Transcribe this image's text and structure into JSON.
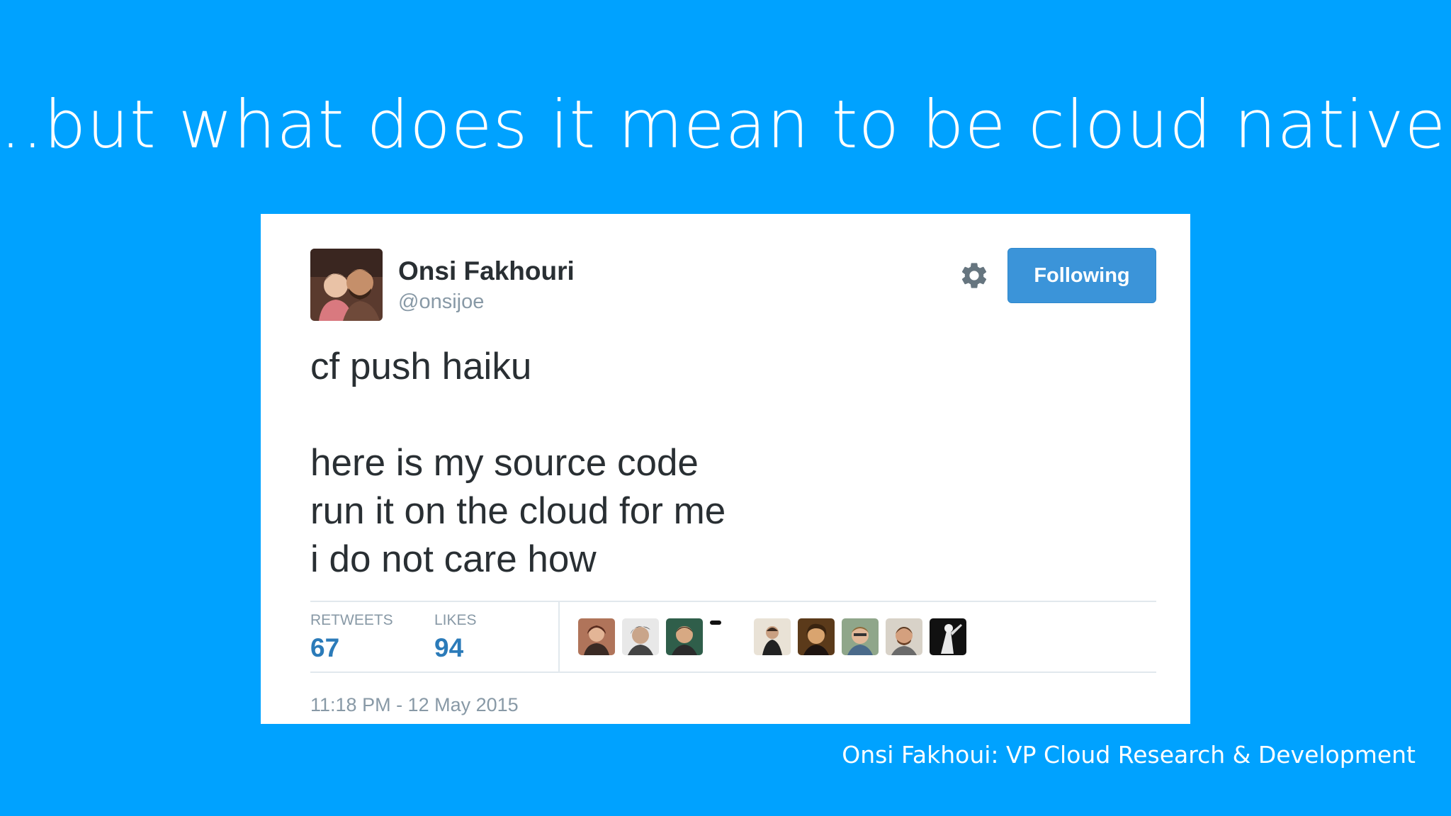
{
  "slide": {
    "title": "..but what does it mean to be cloud native?",
    "footer": "Onsi Fakhoui: VP Cloud Research & Development"
  },
  "tweet": {
    "author": {
      "name": "Onsi Fakhouri",
      "handle": "@onsijoe"
    },
    "follow_button_label": "Following",
    "text_lines": [
      "cf push haiku",
      "",
      "here is my source code",
      "run it on the cloud for me",
      "i do not care how"
    ],
    "stats": {
      "retweets_label": "RETWEETS",
      "retweets_value": "67",
      "likes_label": "LIKES",
      "likes_value": "94"
    },
    "timestamp": "11:18 PM - 12 May 2015"
  },
  "icons": {
    "settings": "gear-icon"
  },
  "colors": {
    "slide_background": "#00a2ff",
    "follow_button": "#3b94d9",
    "stat_value": "#2b7bb9",
    "muted_text": "#8899a6",
    "body_text": "#292f33"
  }
}
